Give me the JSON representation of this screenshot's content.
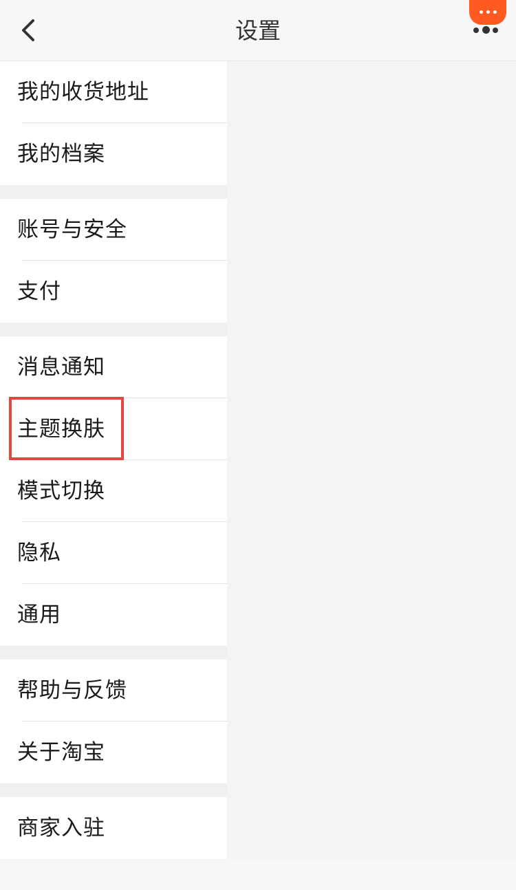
{
  "header": {
    "title": "设置"
  },
  "groups": [
    {
      "items": [
        {
          "label": "我的收货地址"
        },
        {
          "label": "我的档案"
        }
      ]
    },
    {
      "items": [
        {
          "label": "账号与安全"
        },
        {
          "label": "支付"
        }
      ]
    },
    {
      "items": [
        {
          "label": "消息通知"
        },
        {
          "label": "主题换肤"
        },
        {
          "label": "模式切换"
        },
        {
          "label": "隐私"
        },
        {
          "label": "通用"
        }
      ]
    },
    {
      "items": [
        {
          "label": "帮助与反馈"
        },
        {
          "label": "关于淘宝"
        }
      ]
    },
    {
      "items": [
        {
          "label": "商家入驻"
        }
      ]
    }
  ],
  "icons": {
    "back": "chevron-left-icon",
    "more": "more-menu-icon"
  },
  "colors": {
    "accent": "#ff5a1f",
    "highlight": "#e5463e"
  }
}
